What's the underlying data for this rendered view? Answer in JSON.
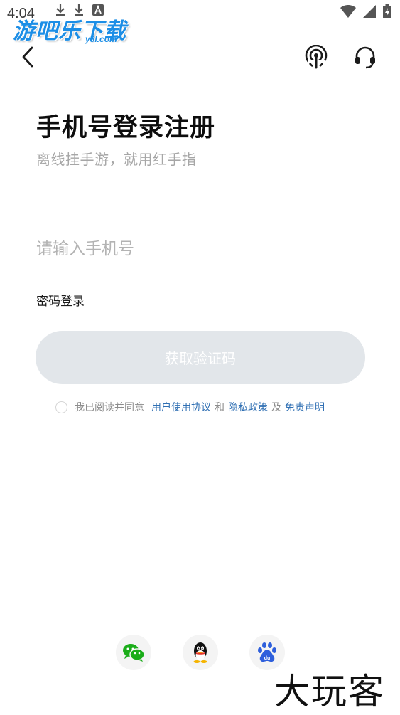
{
  "status_bar": {
    "time": "4:04",
    "icons_left": [
      "download-icon",
      "download-icon",
      "a-box-icon"
    ],
    "icons_right": [
      "wifi-icon",
      "signal-icon",
      "battery-icon"
    ]
  },
  "watermark_top": {
    "text": "游吧乐下载",
    "sub": "y8l.com"
  },
  "header": {
    "back_icon": "chevron-left-icon",
    "right_icons": [
      "broadcast-icon",
      "headset-icon"
    ]
  },
  "login": {
    "title": "手机号登录注册",
    "subtitle": "离线挂手游，就用红手指",
    "phone_placeholder": "请输入手机号",
    "phone_value": "",
    "password_login_label": "密码登录",
    "get_code_label": "获取验证码",
    "get_code_color": "#e2e6ea"
  },
  "agreement": {
    "prefix": "我已阅读并同意",
    "user_agreement": "用户使用协议",
    "and": "和",
    "privacy": "隐私政策",
    "and2": "及",
    "disclaimer": "免责声明",
    "link_color": "#2f6fb3"
  },
  "social_login": [
    "wechat-icon",
    "qq-icon",
    "baidu-icon"
  ],
  "watermark_bottom": "大玩客"
}
